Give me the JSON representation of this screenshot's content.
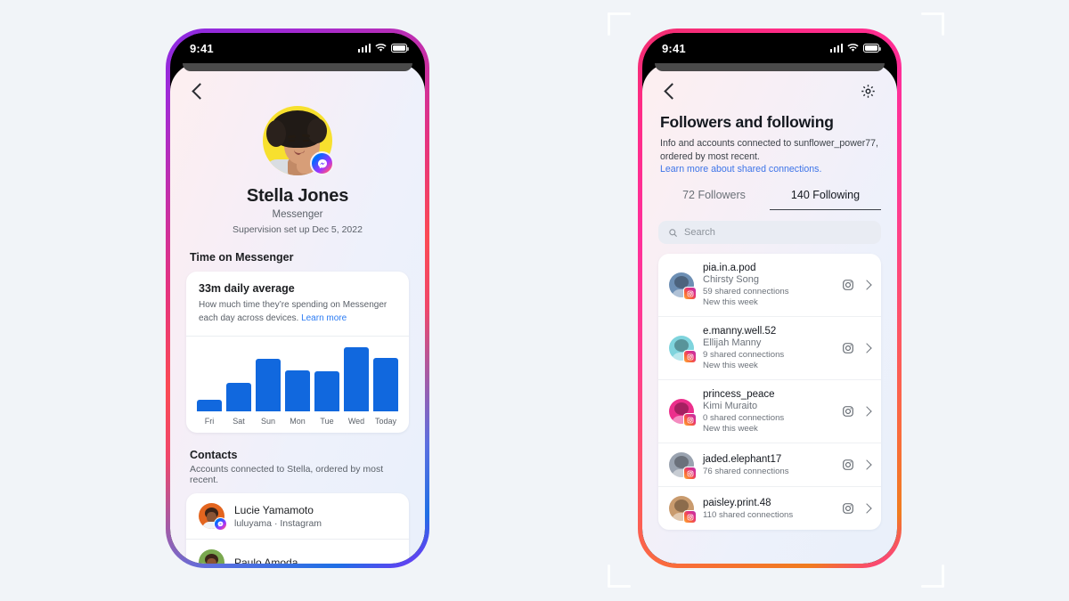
{
  "background_color": "#f1f4f8",
  "left_phone": {
    "frame_gradient": [
      "#8a2be2",
      "#e5337f",
      "#fb4a54",
      "#1f6fe5",
      "#7b2ff7"
    ],
    "status_bar": {
      "time": "9:41",
      "icons": [
        "cellular-signal-icon",
        "wifi-icon",
        "battery-icon"
      ]
    },
    "back_label": "back-chevron",
    "profile": {
      "name": "Stella Jones",
      "app": "Messenger",
      "supervision": "Supervision set up Dec 5, 2022",
      "avatar_badge": "messenger-badge"
    },
    "time_section": {
      "title": "Time on Messenger",
      "card_title": "33m daily average",
      "card_text": "How much time they’re spending on Messenger each day across devices. ",
      "card_link": "Learn more"
    },
    "contacts_section": {
      "title": "Contacts",
      "subtitle": "Accounts connected to Stella, ordered by most recent.",
      "items": [
        {
          "name": "Lucie Yamamoto",
          "meta": "luluyama  ·  Instagram",
          "badge": "messenger-badge",
          "avatar_color": "#e3651f"
        },
        {
          "name": "Paulo Amoda",
          "meta": "",
          "badge": "messenger-badge",
          "avatar_color": "#7aa84f"
        }
      ]
    }
  },
  "right_phone": {
    "frame_gradient": [
      "#f02e6e",
      "#ff2f9a",
      "#ff4f6e",
      "#f07c1f"
    ],
    "status_bar": {
      "time": "9:41",
      "icons": [
        "cellular-signal-icon",
        "wifi-icon",
        "battery-icon"
      ]
    },
    "settings_icon": "gear-icon",
    "title": "Followers and following",
    "description": "Info and accounts connected to sunflower_power77, ordered by most recent.",
    "link": "Learn more about shared connections.",
    "tabs": [
      {
        "label": "72 Followers",
        "active": false
      },
      {
        "label": "140 Following",
        "active": true
      }
    ],
    "search": {
      "placeholder": "Search",
      "value": "",
      "icon": "search-icon"
    },
    "accounts": [
      {
        "username": "pia.in.a.pod",
        "real_name": "Chirsty Song",
        "shared": "59 shared connections",
        "new": "New this week",
        "app_icon": "instagram-icon",
        "avatar_color": "#6d8fb4"
      },
      {
        "username": "e.manny.well.52",
        "real_name": "Ellijah Manny",
        "shared": "9 shared connections",
        "new": "New this week",
        "app_icon": "instagram-icon",
        "avatar_color": "#7fd4dd"
      },
      {
        "username": "princess_peace",
        "real_name": "Kimi Muraito",
        "shared": "0 shared connections",
        "new": "New this week",
        "app_icon": "instagram-icon",
        "avatar_color": "#ec2f8c"
      },
      {
        "username": "jaded.elephant17",
        "real_name": "",
        "shared": "76 shared connections",
        "new": "",
        "app_icon": "instagram-icon",
        "avatar_color": "#9aa3b0"
      },
      {
        "username": "paisley.print.48",
        "real_name": "",
        "shared": "110 shared connections",
        "new": "",
        "app_icon": "instagram-icon",
        "avatar_color": "#c99b6e"
      }
    ]
  },
  "chart_data": {
    "type": "bar",
    "title": "33m daily average",
    "categories": [
      "Fri",
      "Sat",
      "Sun",
      "Mon",
      "Tue",
      "Wed",
      "Today"
    ],
    "values": [
      18,
      44,
      82,
      64,
      62,
      100,
      83
    ],
    "xlabel": "",
    "ylabel": "",
    "ylim": [
      0,
      100
    ],
    "grid": false,
    "legend": "none",
    "bar_color": "#1168de"
  }
}
